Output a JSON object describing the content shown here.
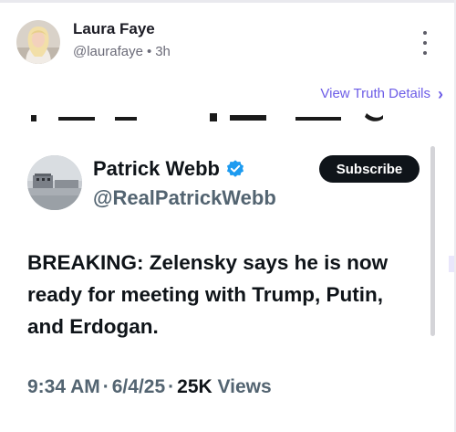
{
  "post": {
    "author_name": "Laura Faye",
    "handle": "@laurafaye",
    "separator": "•",
    "time": "3h",
    "details_link": "View Truth Details",
    "details_chevron": "›",
    "more_icon": "more-vertical-icon"
  },
  "embedded_tweet": {
    "author_name": "Patrick Webb",
    "handle": "@RealPatrickWebb",
    "verified_icon": "verified-badge-icon",
    "subscribe_label": "Subscribe",
    "text": "BREAKING: Zelensky says he is now ready for meeting with Trump, Putin, and Erdogan.",
    "time": "9:34 AM",
    "date": "6/4/25",
    "views_count": "25K",
    "views_label": "Views",
    "meta_separator": "·"
  },
  "colors": {
    "accent": "#6c5ce7",
    "tweet_text": "#0f1419",
    "tweet_secondary": "#536471",
    "verified": "#1d9bf0"
  }
}
